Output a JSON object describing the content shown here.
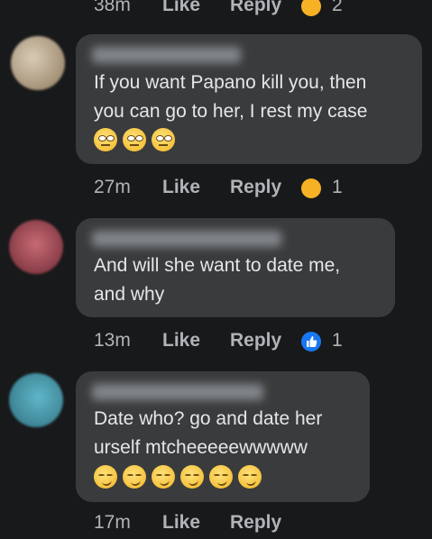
{
  "top_meta": {
    "time": "38m",
    "like": "Like",
    "reply": "Reply",
    "reaction_count": "2",
    "reaction_icon": "haha-reaction-icon"
  },
  "comments": [
    {
      "text_lines": [
        "If you want Papano kill you, then",
        "you can go to her, I rest my case"
      ],
      "emoji_count": 3,
      "emoji_icon": "face-with-rolling-eyes-icon",
      "meta": {
        "time": "27m",
        "like": "Like",
        "reply": "Reply",
        "reaction_count": "1",
        "reaction_icon": "haha-reaction-icon"
      }
    },
    {
      "text_lines": [
        "And will she want to date me,",
        "and why"
      ],
      "emoji_count": 0,
      "meta": {
        "time": "13m",
        "like": "Like",
        "reply": "Reply",
        "reaction_count": "1",
        "reaction_icon": "like-reaction-icon"
      }
    },
    {
      "text_lines": [
        "Date who? go and date her",
        "urself mtcheeeeewwwww"
      ],
      "emoji_count": 6,
      "emoji_icon": "smirking-face-icon",
      "meta": {
        "time": "17m",
        "like": "Like",
        "reply": "Reply"
      }
    }
  ],
  "colors": {
    "background": "#18191a",
    "bubble": "#3a3b3c",
    "meta_text": "#b0b3b8",
    "like_blue": "#1877f2",
    "haha_yellow": "#f7b125"
  }
}
